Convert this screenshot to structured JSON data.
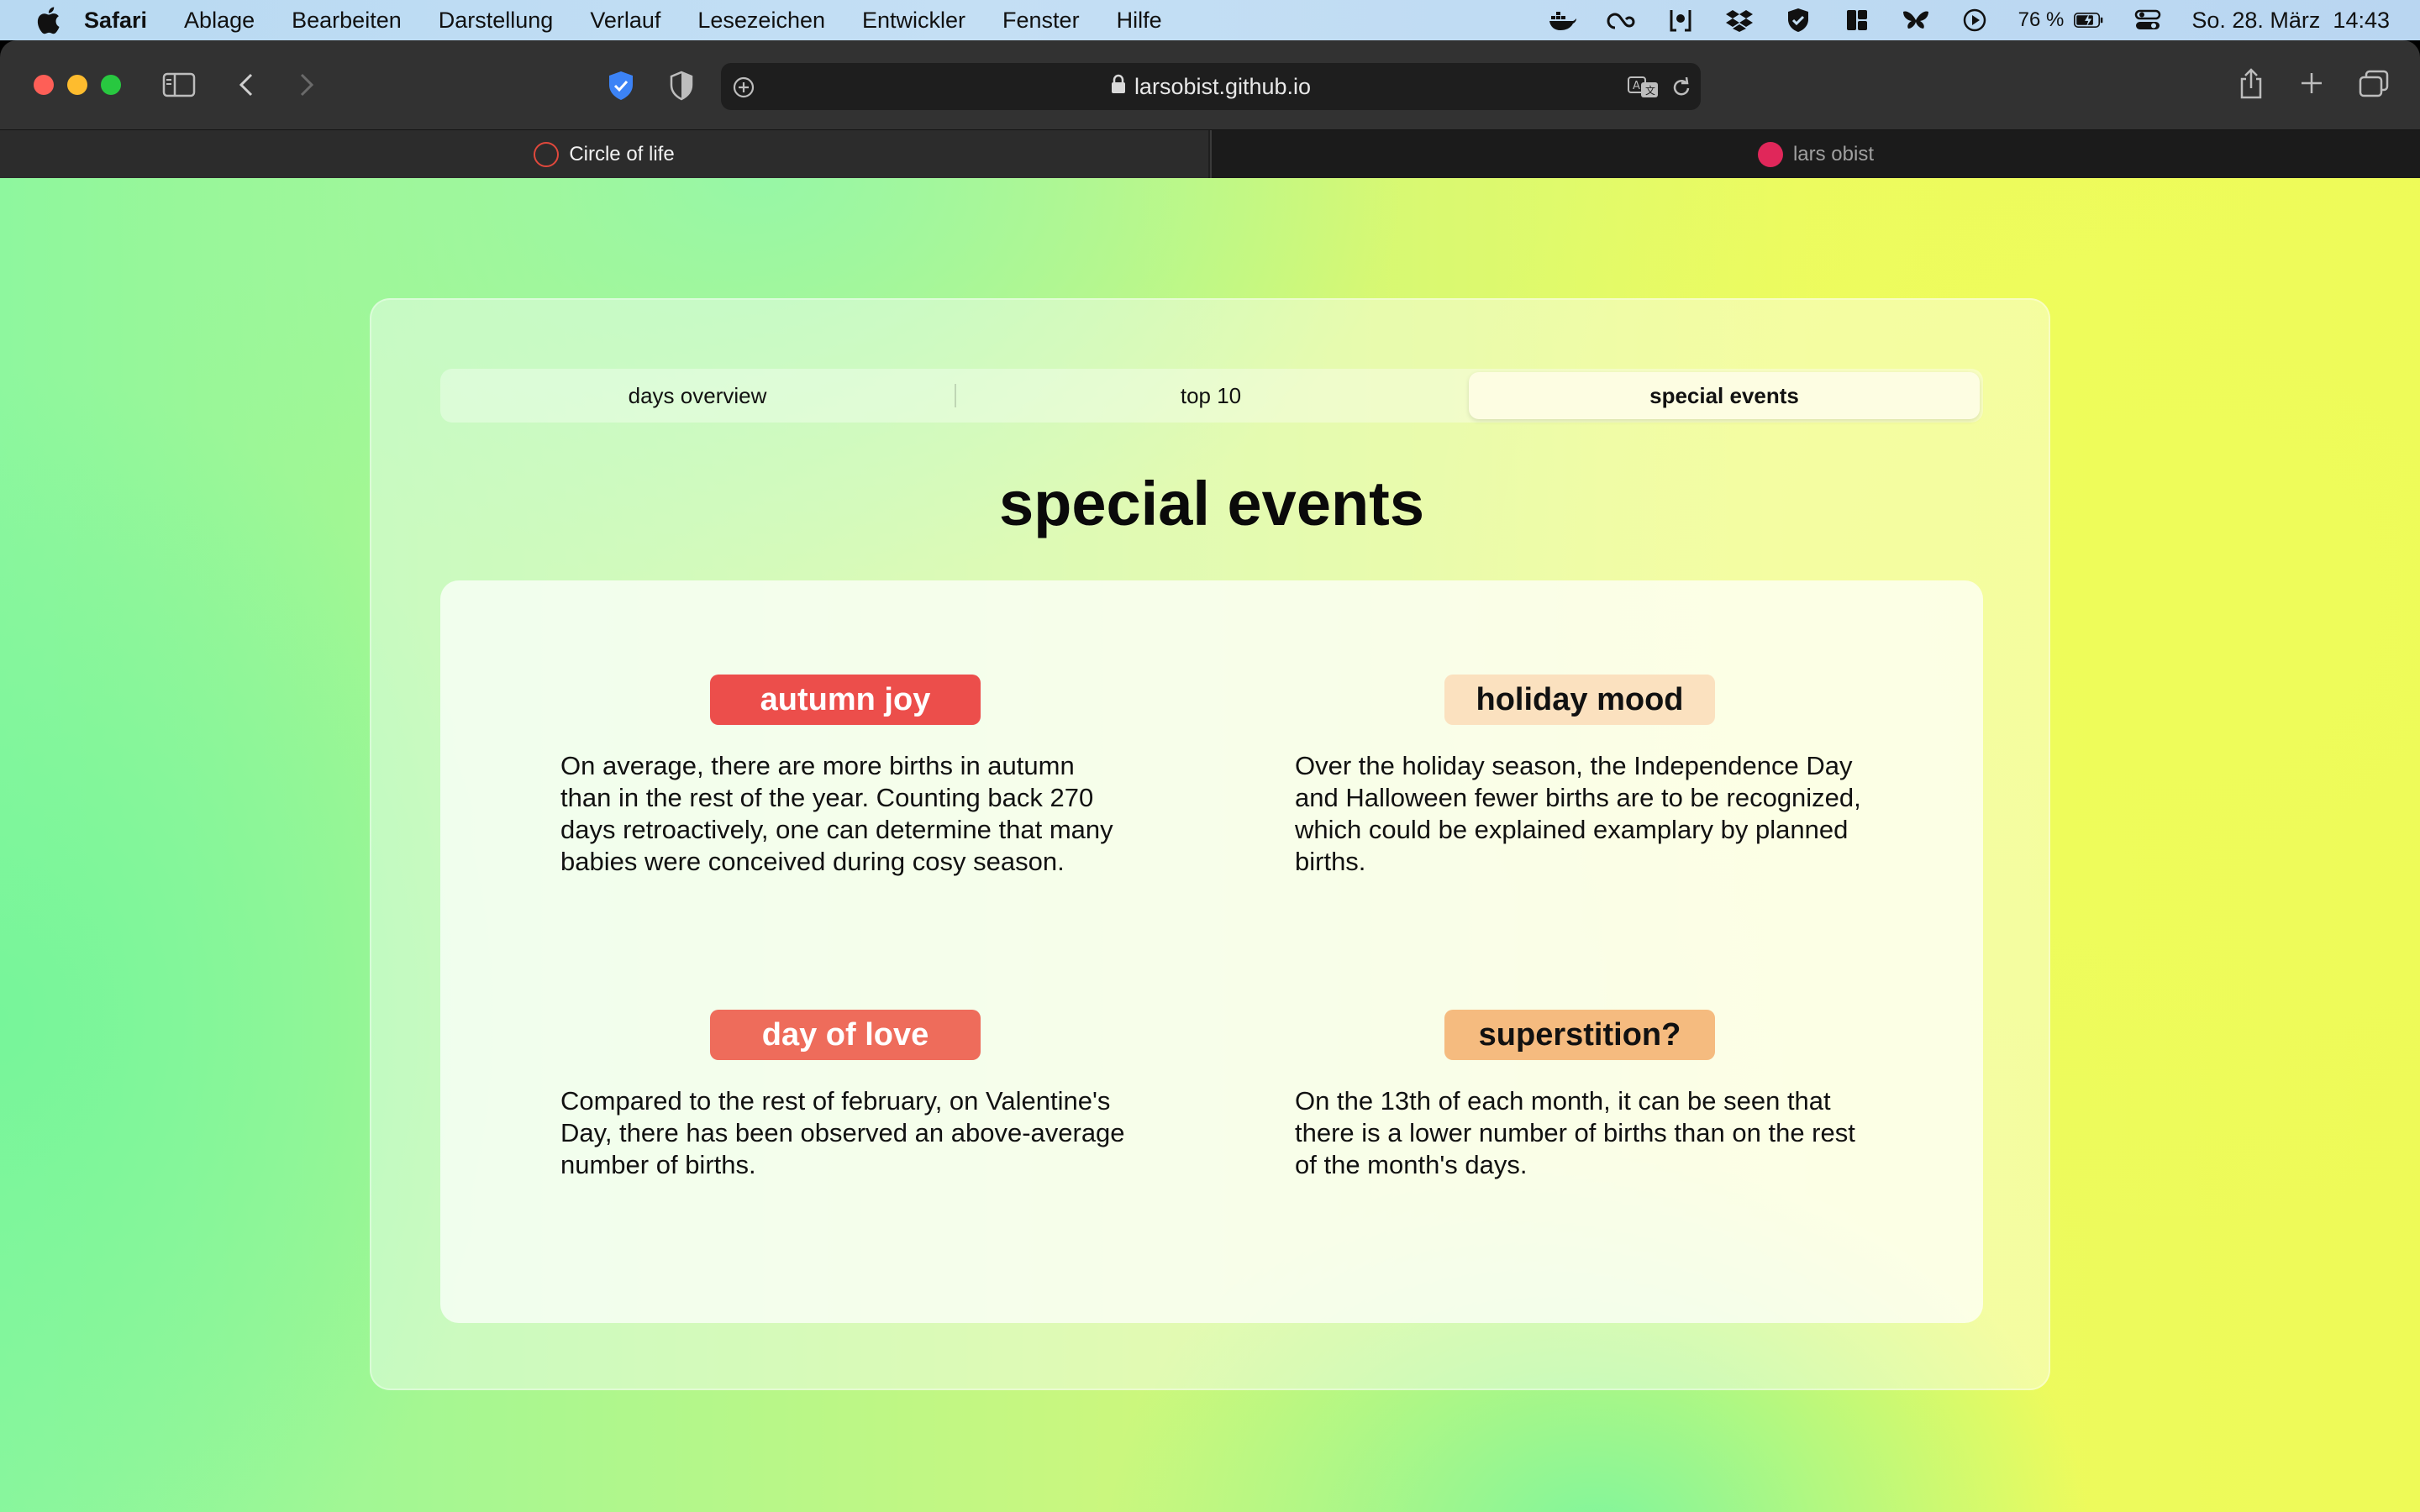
{
  "menubar": {
    "app": "Safari",
    "items": [
      "Ablage",
      "Bearbeiten",
      "Darstellung",
      "Verlauf",
      "Lesezeichen",
      "Entwickler",
      "Fenster",
      "Hilfe"
    ],
    "battery": "76 %",
    "datetime": "So. 28. März  14:43"
  },
  "browser": {
    "url": "larsobist.github.io",
    "tabs": [
      {
        "title": "Circle of life"
      },
      {
        "title": "lars obist"
      }
    ]
  },
  "page": {
    "tabs": [
      "days overview",
      "top 10",
      "special events"
    ],
    "selected_tab": "special events",
    "title": "special events",
    "events": [
      {
        "label": "autumn joy",
        "color": "#ec4e4b",
        "text_color": "#ffffff",
        "text": "On average, there are more births in autumn than in the rest of the year. Counting back 270 days retroactively, one can determine that many babies were conceived during cosy season."
      },
      {
        "label": "holiday mood",
        "color": "#fbe1bf",
        "text_color": "#111111",
        "text": "Over the holiday season, the Independence Day and Halloween fewer births are to be recognized, which could be explained examplary by planned births."
      },
      {
        "label": "day of love",
        "color": "#ee6c5b",
        "text_color": "#ffffff",
        "text": "Compared to the rest of february, on Valentine's Day, there has been observed an above-average number of births."
      },
      {
        "label": "superstition?",
        "color": "#f5bb7f",
        "text_color": "#111111",
        "text": "On the 13th of each month, it can be seen that there is a lower number of births than on the rest of the month's days."
      }
    ]
  }
}
